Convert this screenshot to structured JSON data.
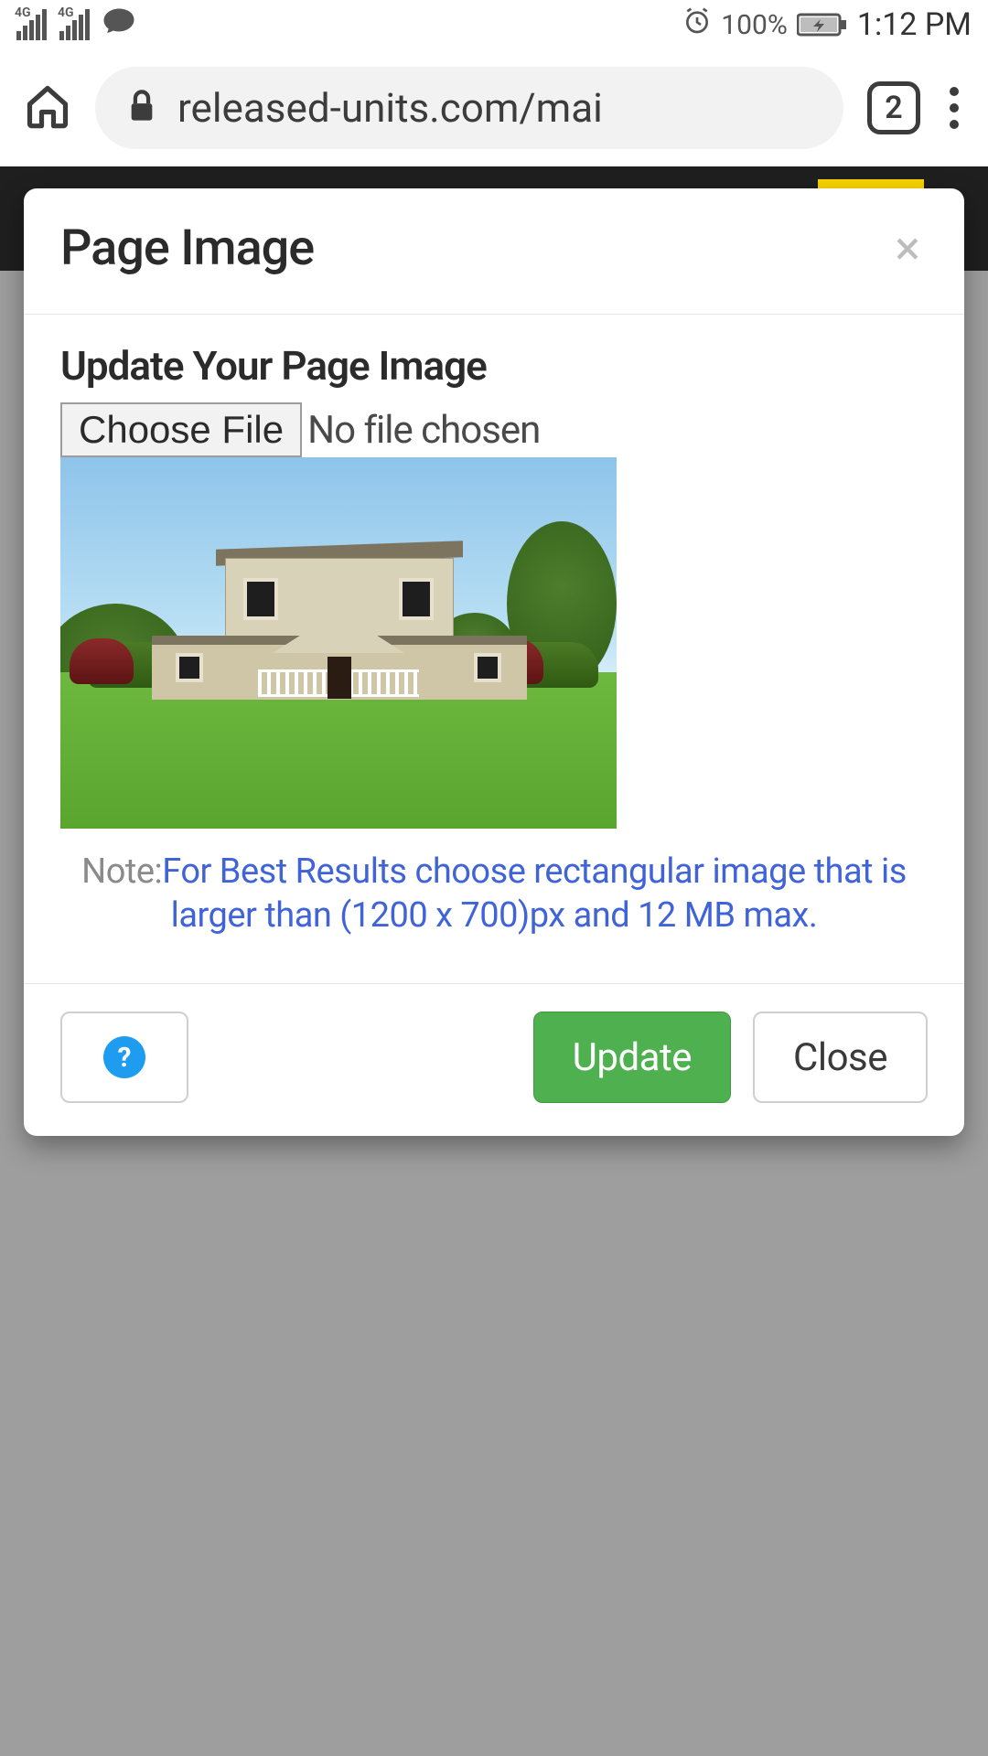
{
  "status_bar": {
    "sig_label_1": "4G",
    "sig_label_2": "4G",
    "battery_pct": "100%",
    "time": "1:12 PM"
  },
  "browser": {
    "url_display": "released-units.com/mai",
    "tab_count": "2"
  },
  "modal": {
    "title": "Page Image",
    "sub_heading": "Update Your Page Image",
    "choose_file_label": "Choose File",
    "file_status": "No file chosen",
    "note_label": "Note:",
    "note_text": "For Best Results choose rectangular image that is larger than (1200 x 700)px and 12 MB max.",
    "help_glyph": "?",
    "update_label": "Update",
    "close_label": "Close",
    "close_x": "×"
  }
}
